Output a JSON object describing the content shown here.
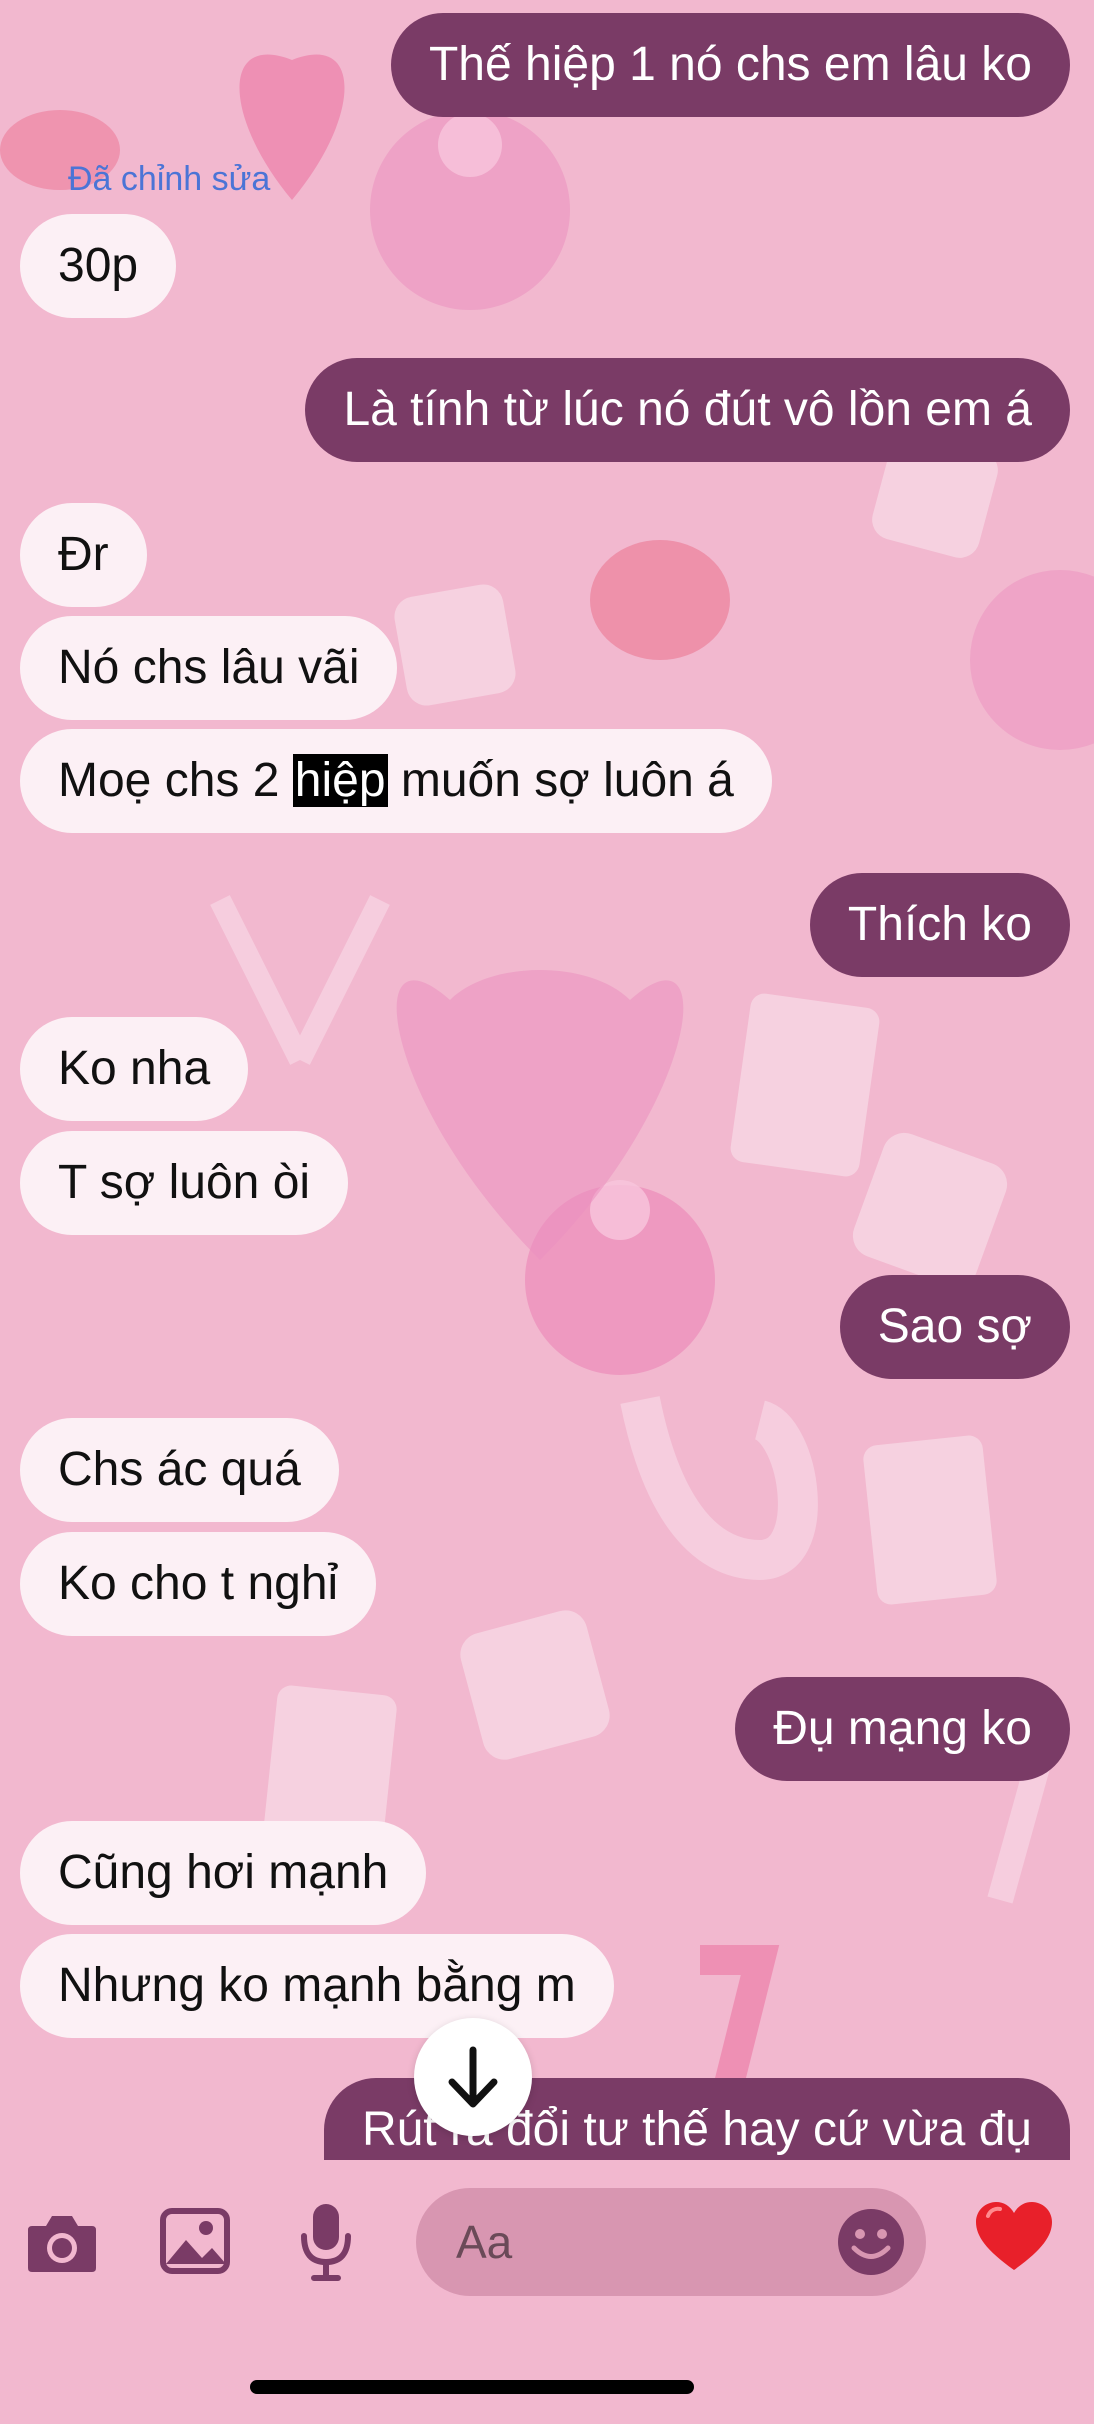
{
  "chat": {
    "edited_label": "Đã chỉnh sửa",
    "messages": [
      {
        "text": "Thế hiệp 1 nó chs em lâu ko",
        "direction": "outgoing"
      },
      {
        "text": "30p",
        "direction": "incoming"
      },
      {
        "text": "Là tính từ lúc nó đút vô lồn em á",
        "direction": "outgoing"
      },
      {
        "text": "Đr",
        "direction": "incoming"
      },
      {
        "text": "Nó chs lâu vãi",
        "direction": "incoming"
      },
      {
        "text_before": "Moẹ chs 2 ",
        "highlight": "hiệp",
        "text_after": " muốn sợ luôn á",
        "direction": "incoming"
      },
      {
        "text": "Thích ko",
        "direction": "outgoing"
      },
      {
        "text": "Ko nha",
        "direction": "incoming"
      },
      {
        "text": "T sợ luôn òi",
        "direction": "incoming"
      },
      {
        "text": "Sao sợ",
        "direction": "outgoing"
      },
      {
        "text": "Chs ác quá",
        "direction": "incoming"
      },
      {
        "text": "Ko cho t nghỉ",
        "direction": "incoming"
      },
      {
        "text": "Đụ mạng ko",
        "direction": "outgoing"
      },
      {
        "text": "Cũng hơi mạnh",
        "direction": "incoming"
      },
      {
        "text": "Nhưng ko mạnh bằng m",
        "direction": "incoming"
      },
      {
        "text": "Rút ra đổi tư thế hay cứ vừa đụ",
        "direction": "outgoing"
      }
    ]
  },
  "composer": {
    "placeholder": "Aa",
    "icons": [
      "camera-icon",
      "image-icon",
      "microphone-icon",
      "emoji-icon",
      "heart-icon"
    ]
  },
  "scroll_button_icon": "arrow-down-icon",
  "colors": {
    "background": "#f2b8cf",
    "incoming_bubble": "#fcf0f5",
    "outgoing_bubble": "#7a3b66",
    "edited_label": "#4b74d6",
    "input_field": "#d896b1",
    "icon": "#7a3b66",
    "heart": "#e8202a"
  }
}
